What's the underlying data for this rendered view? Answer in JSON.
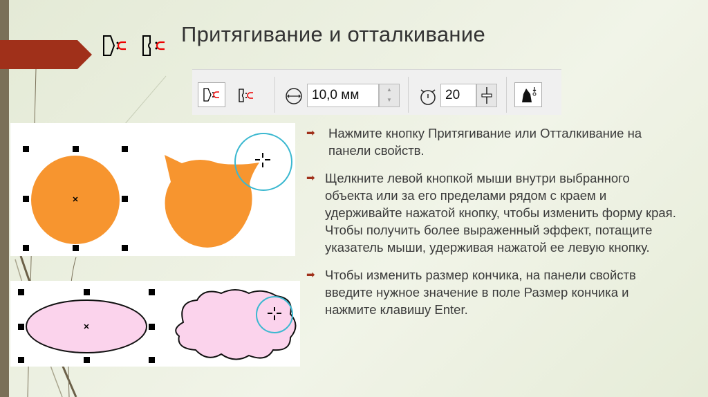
{
  "title": "Притягивание и отталкивание",
  "toolbar": {
    "size_value": "10,0 мм",
    "strength_value": "20"
  },
  "bullets": [
    "Нажмите кнопку Притягивание или Отталкивание на панели свойств.",
    "Щелкните левой кнопкой мыши внутри выбранного объекта или за его пределами рядом с краем и удерживайте нажатой кнопку, чтобы изменить форму края. Чтобы получить более выраженный эффект, потащите указатель мыши, удерживая нажатой ее левую кнопку.",
    "Чтобы изменить размер кончика, на панели свойств введите нужное значение в поле Размер кончика и нажмите клавишу Enter."
  ],
  "colors": {
    "accent": "#a0301a",
    "orange": "#f7952f",
    "pink": "#fbd3ec",
    "cyan": "#3bb8d0"
  }
}
